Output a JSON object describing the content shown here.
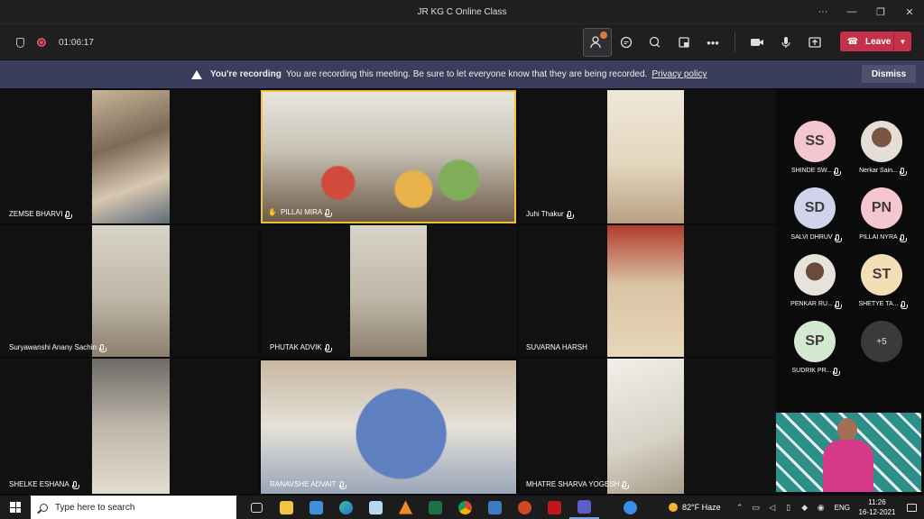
{
  "window": {
    "title": "JR KG C Online Class"
  },
  "toolbar": {
    "timer": "01:06:17",
    "leave_label": "Leave"
  },
  "banner": {
    "strong": "You're recording",
    "text": "You are recording this meeting. Be sure to let everyone know that they are being recorded.",
    "link": "Privacy policy",
    "dismiss_label": "Dismiss"
  },
  "participants": [
    {
      "name": "ZEMSE BHARVI"
    },
    {
      "name": "PILLAI MIRA"
    },
    {
      "name": "Juhi Thakur"
    },
    {
      "name": "Suryawanshi Anany Sachin"
    },
    {
      "name": "PHUTAK ADVIK"
    },
    {
      "name": "SUVARNA HARSH"
    },
    {
      "name": "SHELKE ESHANA"
    },
    {
      "name": "RANAVSHE ADVAIT"
    },
    {
      "name": "MHATRE SHARVA YOGESH"
    }
  ],
  "roster": [
    {
      "initials": "SS",
      "name": "SHINDE SW...",
      "color": "#f4c6d0"
    },
    {
      "initials": "",
      "name": "Nerkar Sain...",
      "color": "#d9d3cb"
    },
    {
      "initials": "SD",
      "name": "SALVI DHRUV",
      "color": "#cfd3ec"
    },
    {
      "initials": "PN",
      "name": "PILLAI NYRA",
      "color": "#f4c6d0"
    },
    {
      "initials": "",
      "name": "PENKAR RU...",
      "color": "#e6e1d7"
    },
    {
      "initials": "ST",
      "name": "SHETYE TA...",
      "color": "#f3dfb6"
    },
    {
      "initials": "SP",
      "name": "SUDRIK PR...",
      "color": "#d3ead0"
    },
    {
      "initials": "+5",
      "name": "",
      "color": "#3a3a3c"
    }
  ],
  "taskbar": {
    "search_placeholder": "Type here to search",
    "weather": "82°F  Haze",
    "lang": "ENG",
    "time": "11:26",
    "date": "16-12-2021"
  }
}
